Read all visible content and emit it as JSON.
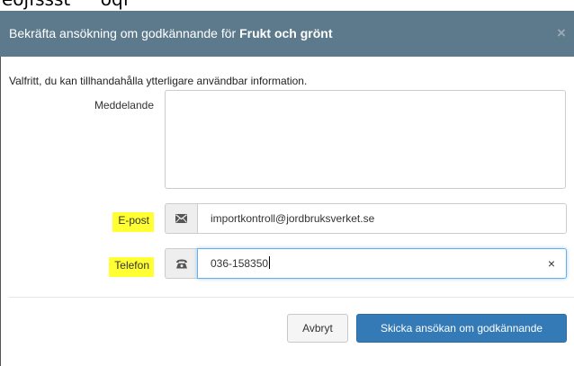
{
  "top_crop_text": "ēojfssst^^oqf",
  "modal": {
    "title_prefix": "Bekräfta ansökning om godkännande för",
    "title_bold": "Frukt och grönt",
    "close_glyph": "×"
  },
  "form": {
    "help_text": "Valfritt, du kan tillhandahålla ytterligare användbar information.",
    "message_label": "Meddelande",
    "message_value": "",
    "email_label": "E-post",
    "email_value": "importkontroll@jordbruksverket.se",
    "phone_label": "Telefon",
    "phone_value": "036-158350",
    "phone_clear": "×"
  },
  "buttons": {
    "cancel": "Avbryt",
    "submit": "Skicka ansökan om godkännande"
  },
  "icons": {
    "email": "envelope-icon",
    "phone": "phone-icon"
  },
  "colors": {
    "header": "#5c7a8c",
    "primary": "#337ab7",
    "highlight": "#ffff33"
  }
}
